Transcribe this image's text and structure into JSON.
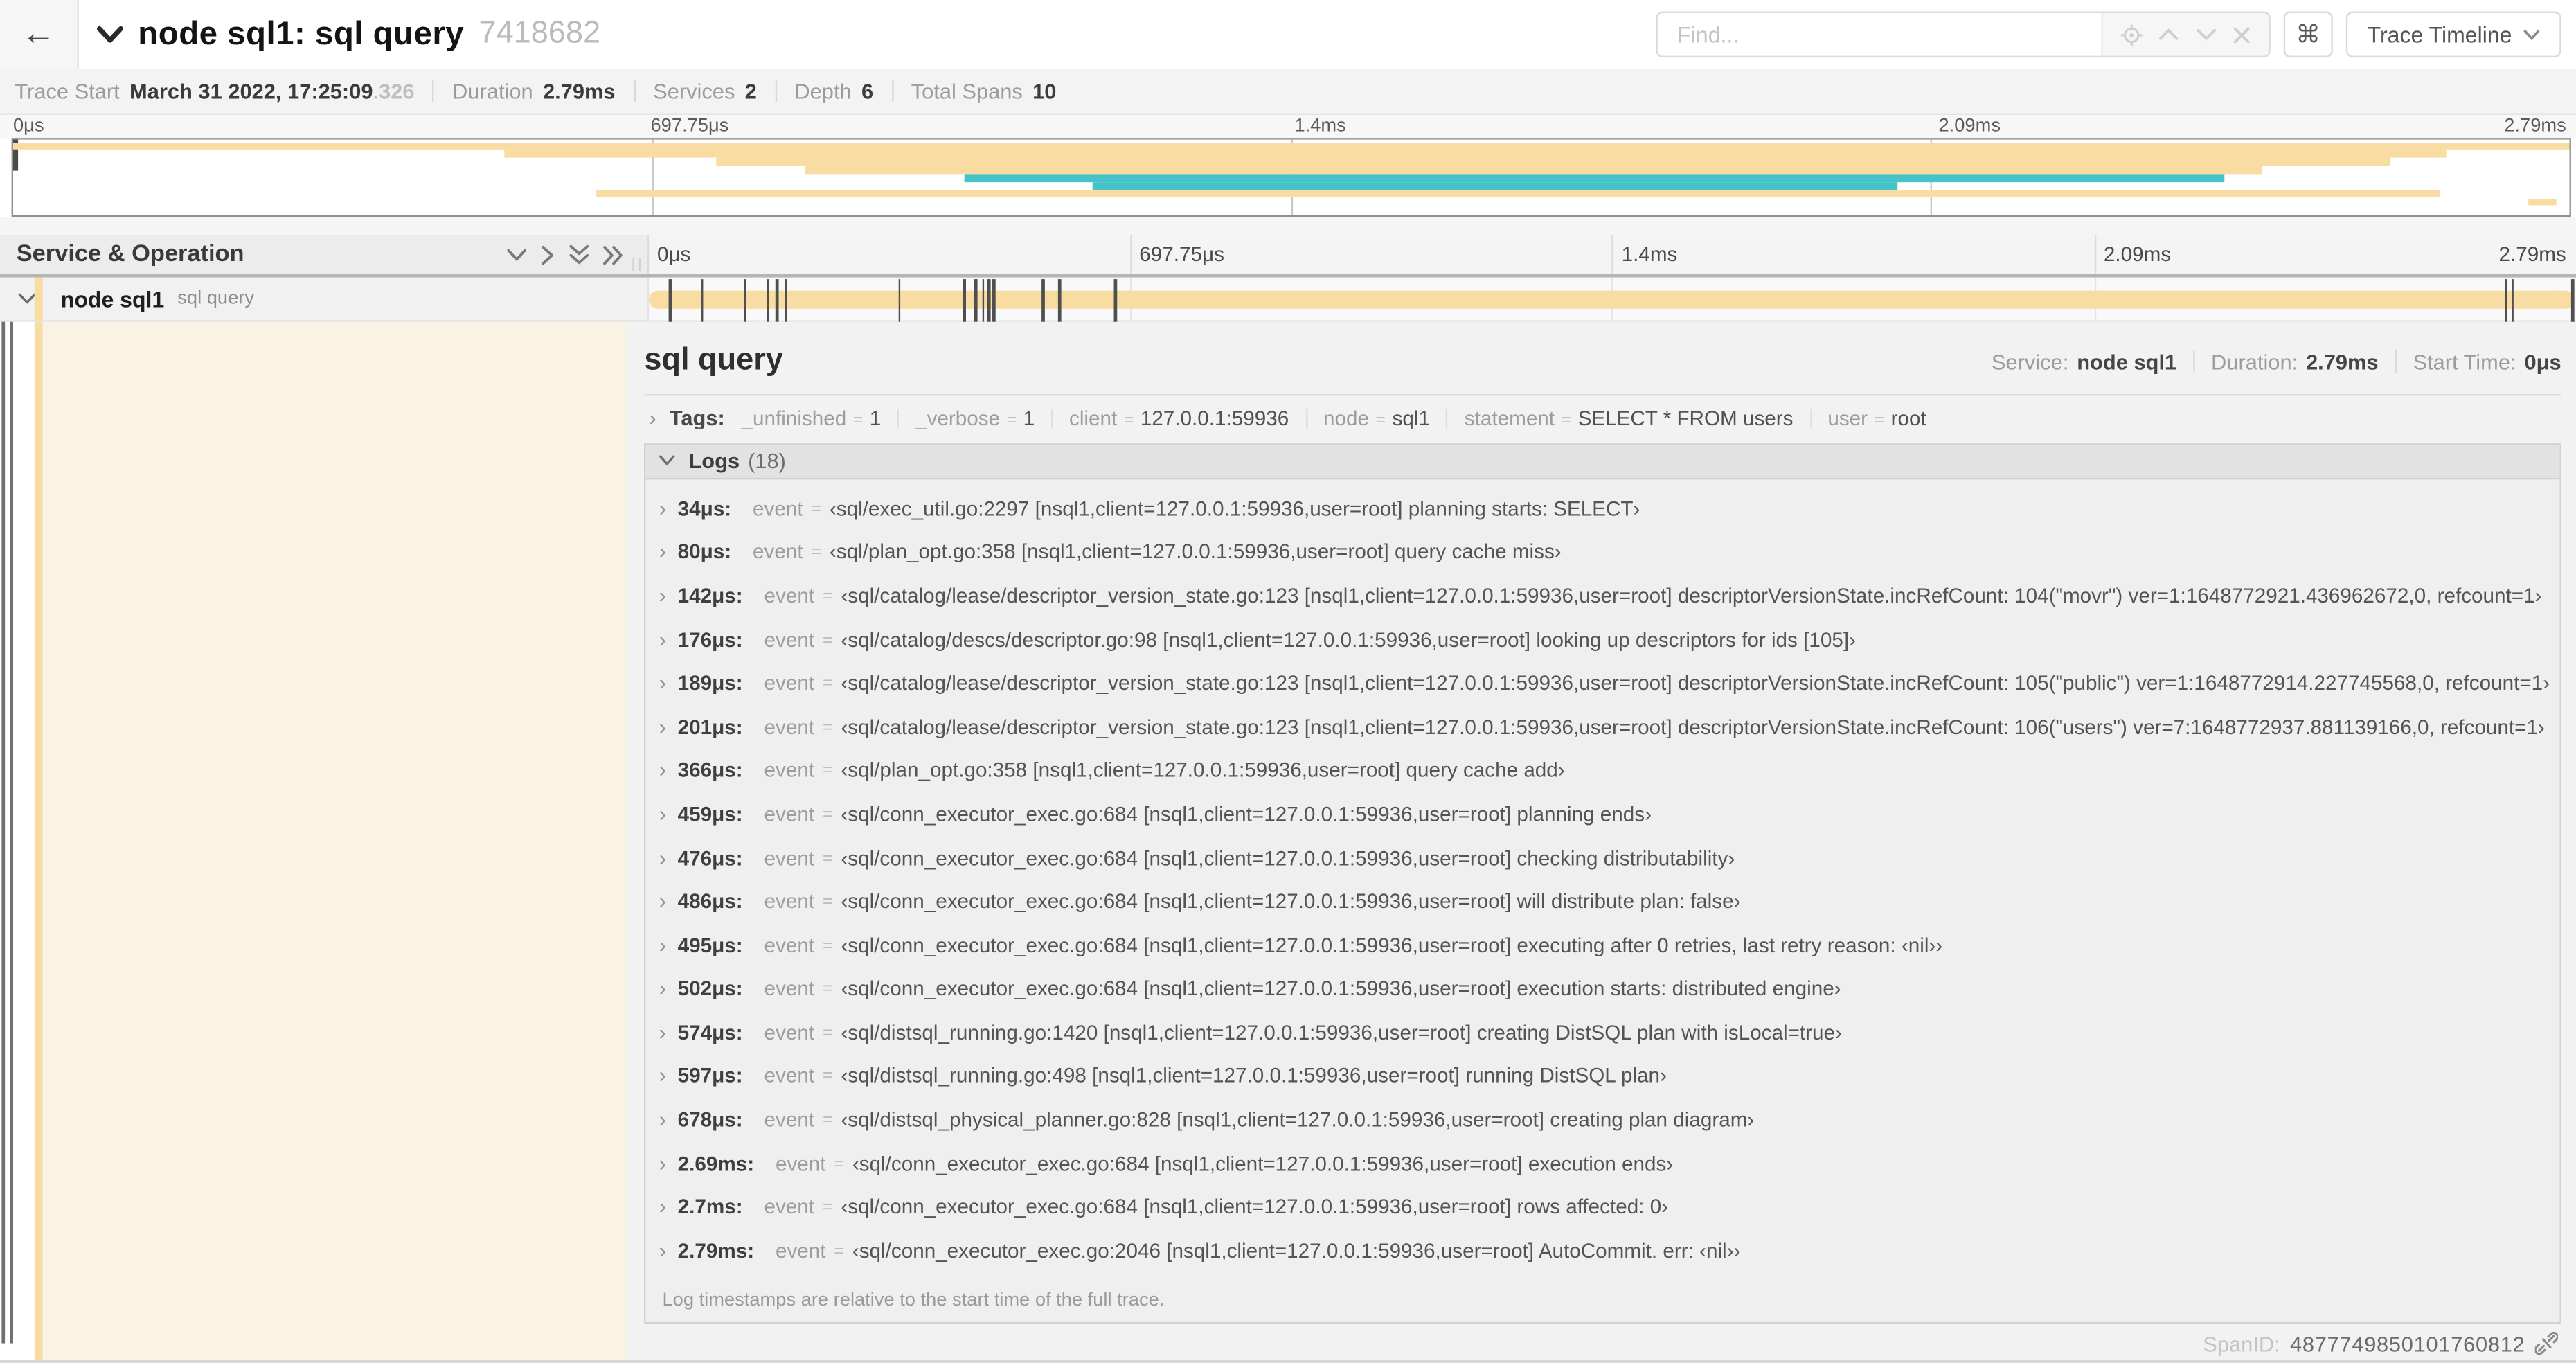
{
  "header": {
    "back_icon": "left-arrow",
    "title": "node sql1: sql query",
    "trace_id": "7418682",
    "find_placeholder": "Find...",
    "shortcut_key": "⌘",
    "view_selector_label": "Trace Timeline"
  },
  "stats": [
    {
      "label": "Trace Start",
      "value": "March 31 2022, 17:25:09",
      "suffix": ".326"
    },
    {
      "label": "Duration",
      "value": "2.79ms"
    },
    {
      "label": "Services",
      "value": "2"
    },
    {
      "label": "Depth",
      "value": "6"
    },
    {
      "label": "Total Spans",
      "value": "10"
    }
  ],
  "time_ticks": [
    {
      "label": "0μs",
      "pct": 0
    },
    {
      "label": "697.75μs",
      "pct": 25
    },
    {
      "label": "1.4ms",
      "pct": 50
    },
    {
      "label": "2.09ms",
      "pct": 75
    },
    {
      "label": "2.79ms",
      "pct": 100,
      "align": "right"
    }
  ],
  "colors": {
    "tan": "#F8DCA1",
    "teal": "#46C3C9",
    "cream": "#FAF3E3"
  },
  "minimap": {
    "grid_pct": [
      25,
      50,
      75
    ],
    "spans": [
      {
        "row": 0,
        "start": 0,
        "end": 100,
        "color": "#F8DCA1"
      },
      {
        "row": 1,
        "start": 19.2,
        "end": 95.2,
        "color": "#F8DCA1"
      },
      {
        "row": 2,
        "start": 27.5,
        "end": 93.0,
        "color": "#F8DCA1"
      },
      {
        "row": 3,
        "start": 31.0,
        "end": 88.0,
        "color": "#F8DCA1"
      },
      {
        "row": 4,
        "start": 37.2,
        "end": 86.5,
        "color": "#46C3C9"
      },
      {
        "row": 5,
        "start": 42.2,
        "end": 73.7,
        "color": "#46C3C9"
      },
      {
        "row": 6,
        "start": 22.8,
        "end": 94.9,
        "color": "#F8DCA1"
      },
      {
        "row": 7,
        "start": 98.4,
        "end": 99.5,
        "color": "#F8DCA1"
      }
    ]
  },
  "grid_header": {
    "title": "Service & Operation"
  },
  "span_row": {
    "service": "node sql1",
    "operation": "sql query",
    "bar_color": "#F8DCA1",
    "log_tick_pct": [
      1.22,
      2.87,
      5.09,
      6.31,
      6.77,
      7.2,
      13.12,
      16.45,
      17.06,
      17.42,
      17.74,
      17.99,
      20.57,
      21.4,
      24.3,
      96.42,
      96.77,
      99.85
    ]
  },
  "detail": {
    "title": "sql query",
    "meta": [
      {
        "label": "Service:",
        "value": "node sql1"
      },
      {
        "label": "Duration:",
        "value": "2.79ms"
      },
      {
        "label": "Start Time:",
        "value": "0μs"
      }
    ],
    "tags_label": "Tags:",
    "tags": [
      {
        "key": "_unfinished",
        "value": "1"
      },
      {
        "key": "_verbose",
        "value": "1"
      },
      {
        "key": "client",
        "value": "127.0.0.1:59936"
      },
      {
        "key": "node",
        "value": "sql1"
      },
      {
        "key": "statement",
        "value": "SELECT * FROM users"
      },
      {
        "key": "user",
        "value": "root"
      }
    ],
    "logs_title": "Logs",
    "logs_count": "(18)",
    "logs": [
      {
        "time": "34μs:",
        "field": "event",
        "value": "‹sql/exec_util.go:2297 [nsql1,client=127.0.0.1:59936,user=root] planning starts: SELECT›"
      },
      {
        "time": "80μs:",
        "field": "event",
        "value": "‹sql/plan_opt.go:358 [nsql1,client=127.0.0.1:59936,user=root] query cache miss›"
      },
      {
        "time": "142μs:",
        "field": "event",
        "value": "‹sql/catalog/lease/descriptor_version_state.go:123 [nsql1,client=127.0.0.1:59936,user=root] descriptorVersionState.incRefCount: 104(\"movr\") ver=1:1648772921.436962672,0, refcount=1›"
      },
      {
        "time": "176μs:",
        "field": "event",
        "value": "‹sql/catalog/descs/descriptor.go:98 [nsql1,client=127.0.0.1:59936,user=root] looking up descriptors for ids [105]›"
      },
      {
        "time": "189μs:",
        "field": "event",
        "value": "‹sql/catalog/lease/descriptor_version_state.go:123 [nsql1,client=127.0.0.1:59936,user=root] descriptorVersionState.incRefCount: 105(\"public\") ver=1:1648772914.227745568,0, refcount=1›"
      },
      {
        "time": "201μs:",
        "field": "event",
        "value": "‹sql/catalog/lease/descriptor_version_state.go:123 [nsql1,client=127.0.0.1:59936,user=root] descriptorVersionState.incRefCount: 106(\"users\") ver=7:1648772937.881139166,0, refcount=1›"
      },
      {
        "time": "366μs:",
        "field": "event",
        "value": "‹sql/plan_opt.go:358 [nsql1,client=127.0.0.1:59936,user=root] query cache add›"
      },
      {
        "time": "459μs:",
        "field": "event",
        "value": "‹sql/conn_executor_exec.go:684 [nsql1,client=127.0.0.1:59936,user=root] planning ends›"
      },
      {
        "time": "476μs:",
        "field": "event",
        "value": "‹sql/conn_executor_exec.go:684 [nsql1,client=127.0.0.1:59936,user=root] checking distributability›"
      },
      {
        "time": "486μs:",
        "field": "event",
        "value": "‹sql/conn_executor_exec.go:684 [nsql1,client=127.0.0.1:59936,user=root] will distribute plan: false›"
      },
      {
        "time": "495μs:",
        "field": "event",
        "value": "‹sql/conn_executor_exec.go:684 [nsql1,client=127.0.0.1:59936,user=root] executing after 0 retries, last retry reason: ‹nil››"
      },
      {
        "time": "502μs:",
        "field": "event",
        "value": "‹sql/conn_executor_exec.go:684 [nsql1,client=127.0.0.1:59936,user=root] execution starts: distributed engine›"
      },
      {
        "time": "574μs:",
        "field": "event",
        "value": "‹sql/distsql_running.go:1420 [nsql1,client=127.0.0.1:59936,user=root] creating DistSQL plan with isLocal=true›"
      },
      {
        "time": "597μs:",
        "field": "event",
        "value": "‹sql/distsql_running.go:498 [nsql1,client=127.0.0.1:59936,user=root] running DistSQL plan›"
      },
      {
        "time": "678μs:",
        "field": "event",
        "value": "‹sql/distsql_physical_planner.go:828 [nsql1,client=127.0.0.1:59936,user=root] creating plan diagram›"
      },
      {
        "time": "2.69ms:",
        "field": "event",
        "value": "‹sql/conn_executor_exec.go:684 [nsql1,client=127.0.0.1:59936,user=root] execution ends›"
      },
      {
        "time": "2.7ms:",
        "field": "event",
        "value": "‹sql/conn_executor_exec.go:684 [nsql1,client=127.0.0.1:59936,user=root] rows affected: 0›"
      },
      {
        "time": "2.79ms:",
        "field": "event",
        "value": "‹sql/conn_executor_exec.go:2046 [nsql1,client=127.0.0.1:59936,user=root] AutoCommit. err: ‹nil››"
      }
    ],
    "logs_note": "Log timestamps are relative to the start time of the full trace.",
    "spanid_label": "SpanID:",
    "spanid_value": "4877749850101760812"
  }
}
